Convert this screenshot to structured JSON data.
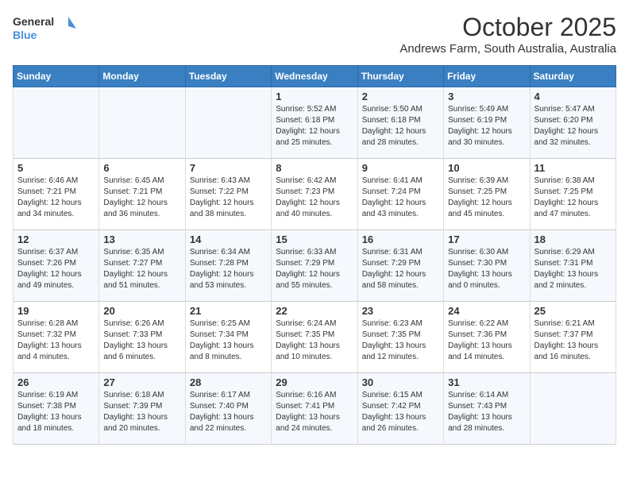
{
  "logo": {
    "general": "General",
    "blue": "Blue"
  },
  "header": {
    "month": "October 2025",
    "location": "Andrews Farm, South Australia, Australia"
  },
  "days_of_week": [
    "Sunday",
    "Monday",
    "Tuesday",
    "Wednesday",
    "Thursday",
    "Friday",
    "Saturday"
  ],
  "weeks": [
    [
      {
        "day": "",
        "content": ""
      },
      {
        "day": "",
        "content": ""
      },
      {
        "day": "",
        "content": ""
      },
      {
        "day": "1",
        "content": "Sunrise: 5:52 AM\nSunset: 6:18 PM\nDaylight: 12 hours\nand 25 minutes."
      },
      {
        "day": "2",
        "content": "Sunrise: 5:50 AM\nSunset: 6:18 PM\nDaylight: 12 hours\nand 28 minutes."
      },
      {
        "day": "3",
        "content": "Sunrise: 5:49 AM\nSunset: 6:19 PM\nDaylight: 12 hours\nand 30 minutes."
      },
      {
        "day": "4",
        "content": "Sunrise: 5:47 AM\nSunset: 6:20 PM\nDaylight: 12 hours\nand 32 minutes."
      }
    ],
    [
      {
        "day": "5",
        "content": "Sunrise: 6:46 AM\nSunset: 7:21 PM\nDaylight: 12 hours\nand 34 minutes."
      },
      {
        "day": "6",
        "content": "Sunrise: 6:45 AM\nSunset: 7:21 PM\nDaylight: 12 hours\nand 36 minutes."
      },
      {
        "day": "7",
        "content": "Sunrise: 6:43 AM\nSunset: 7:22 PM\nDaylight: 12 hours\nand 38 minutes."
      },
      {
        "day": "8",
        "content": "Sunrise: 6:42 AM\nSunset: 7:23 PM\nDaylight: 12 hours\nand 40 minutes."
      },
      {
        "day": "9",
        "content": "Sunrise: 6:41 AM\nSunset: 7:24 PM\nDaylight: 12 hours\nand 43 minutes."
      },
      {
        "day": "10",
        "content": "Sunrise: 6:39 AM\nSunset: 7:25 PM\nDaylight: 12 hours\nand 45 minutes."
      },
      {
        "day": "11",
        "content": "Sunrise: 6:38 AM\nSunset: 7:25 PM\nDaylight: 12 hours\nand 47 minutes."
      }
    ],
    [
      {
        "day": "12",
        "content": "Sunrise: 6:37 AM\nSunset: 7:26 PM\nDaylight: 12 hours\nand 49 minutes."
      },
      {
        "day": "13",
        "content": "Sunrise: 6:35 AM\nSunset: 7:27 PM\nDaylight: 12 hours\nand 51 minutes."
      },
      {
        "day": "14",
        "content": "Sunrise: 6:34 AM\nSunset: 7:28 PM\nDaylight: 12 hours\nand 53 minutes."
      },
      {
        "day": "15",
        "content": "Sunrise: 6:33 AM\nSunset: 7:29 PM\nDaylight: 12 hours\nand 55 minutes."
      },
      {
        "day": "16",
        "content": "Sunrise: 6:31 AM\nSunset: 7:29 PM\nDaylight: 12 hours\nand 58 minutes."
      },
      {
        "day": "17",
        "content": "Sunrise: 6:30 AM\nSunset: 7:30 PM\nDaylight: 13 hours\nand 0 minutes."
      },
      {
        "day": "18",
        "content": "Sunrise: 6:29 AM\nSunset: 7:31 PM\nDaylight: 13 hours\nand 2 minutes."
      }
    ],
    [
      {
        "day": "19",
        "content": "Sunrise: 6:28 AM\nSunset: 7:32 PM\nDaylight: 13 hours\nand 4 minutes."
      },
      {
        "day": "20",
        "content": "Sunrise: 6:26 AM\nSunset: 7:33 PM\nDaylight: 13 hours\nand 6 minutes."
      },
      {
        "day": "21",
        "content": "Sunrise: 6:25 AM\nSunset: 7:34 PM\nDaylight: 13 hours\nand 8 minutes."
      },
      {
        "day": "22",
        "content": "Sunrise: 6:24 AM\nSunset: 7:35 PM\nDaylight: 13 hours\nand 10 minutes."
      },
      {
        "day": "23",
        "content": "Sunrise: 6:23 AM\nSunset: 7:35 PM\nDaylight: 13 hours\nand 12 minutes."
      },
      {
        "day": "24",
        "content": "Sunrise: 6:22 AM\nSunset: 7:36 PM\nDaylight: 13 hours\nand 14 minutes."
      },
      {
        "day": "25",
        "content": "Sunrise: 6:21 AM\nSunset: 7:37 PM\nDaylight: 13 hours\nand 16 minutes."
      }
    ],
    [
      {
        "day": "26",
        "content": "Sunrise: 6:19 AM\nSunset: 7:38 PM\nDaylight: 13 hours\nand 18 minutes."
      },
      {
        "day": "27",
        "content": "Sunrise: 6:18 AM\nSunset: 7:39 PM\nDaylight: 13 hours\nand 20 minutes."
      },
      {
        "day": "28",
        "content": "Sunrise: 6:17 AM\nSunset: 7:40 PM\nDaylight: 13 hours\nand 22 minutes."
      },
      {
        "day": "29",
        "content": "Sunrise: 6:16 AM\nSunset: 7:41 PM\nDaylight: 13 hours\nand 24 minutes."
      },
      {
        "day": "30",
        "content": "Sunrise: 6:15 AM\nSunset: 7:42 PM\nDaylight: 13 hours\nand 26 minutes."
      },
      {
        "day": "31",
        "content": "Sunrise: 6:14 AM\nSunset: 7:43 PM\nDaylight: 13 hours\nand 28 minutes."
      },
      {
        "day": "",
        "content": ""
      }
    ]
  ]
}
